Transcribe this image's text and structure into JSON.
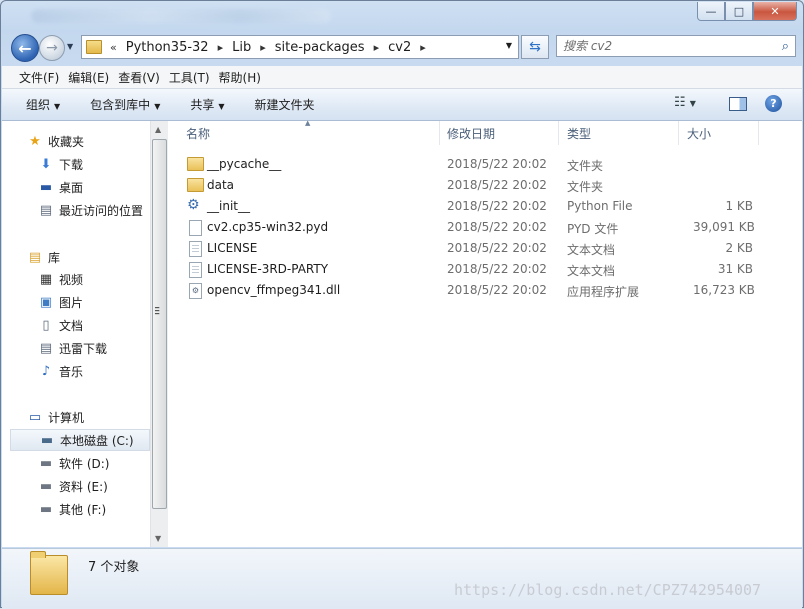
{
  "window": {
    "controls": {
      "minimize": "—",
      "maximize": "□",
      "close": "✕"
    }
  },
  "nav": {
    "back_glyph": "←",
    "forward_glyph": "→",
    "address": {
      "overflow": "«",
      "crumbs": [
        "Python35-32",
        "Lib",
        "site-packages",
        "cv2"
      ]
    },
    "search_placeholder": "搜索 cv2"
  },
  "menu": [
    "文件(F)",
    "编辑(E)",
    "查看(V)",
    "工具(T)",
    "帮助(H)"
  ],
  "toolbar": {
    "organize": "组织",
    "include_library": "包含到库中",
    "share": "共享",
    "new_folder": "新建文件夹",
    "help_glyph": "?"
  },
  "sidebar": {
    "favorites": {
      "label": "收藏夹",
      "items": [
        "下载",
        "桌面",
        "最近访问的位置"
      ]
    },
    "libraries": {
      "label": "库",
      "items": [
        "视频",
        "图片",
        "文档",
        "迅雷下载",
        "音乐"
      ]
    },
    "computer": {
      "label": "计算机",
      "items": [
        "本地磁盘 (C:)",
        "软件 (D:)",
        "资料 (E:)",
        "其他 (F:)"
      ]
    }
  },
  "columns": {
    "name": "名称",
    "date": "修改日期",
    "type": "类型",
    "size": "大小"
  },
  "files": [
    {
      "name": "__pycache__",
      "date": "2018/5/22 20:02",
      "type": "文件夹",
      "size": "",
      "icon": "folder-icon"
    },
    {
      "name": "data",
      "date": "2018/5/22 20:02",
      "type": "文件夹",
      "size": "",
      "icon": "folder-icon"
    },
    {
      "name": "__init__",
      "date": "2018/5/22 20:02",
      "type": "Python File",
      "size": "1 KB",
      "icon": "python-file-icon"
    },
    {
      "name": "cv2.cp35-win32.pyd",
      "date": "2018/5/22 20:02",
      "type": "PYD 文件",
      "size": "39,091 KB",
      "icon": "file-icon"
    },
    {
      "name": "LICENSE",
      "date": "2018/5/22 20:02",
      "type": "文本文档",
      "size": "2 KB",
      "icon": "text-file-icon"
    },
    {
      "name": "LICENSE-3RD-PARTY",
      "date": "2018/5/22 20:02",
      "type": "文本文档",
      "size": "31 KB",
      "icon": "text-file-icon"
    },
    {
      "name": "opencv_ffmpeg341.dll",
      "date": "2018/5/22 20:02",
      "type": "应用程序扩展",
      "size": "16,723 KB",
      "icon": "dll-file-icon"
    }
  ],
  "details": {
    "count": "7 个对象",
    "watermark": "https://blog.csdn.net/CPZ742954007"
  },
  "colors": {
    "accent": "#2e63b3",
    "frame": "#c9dbf0",
    "selection": "#e0e8f1"
  }
}
